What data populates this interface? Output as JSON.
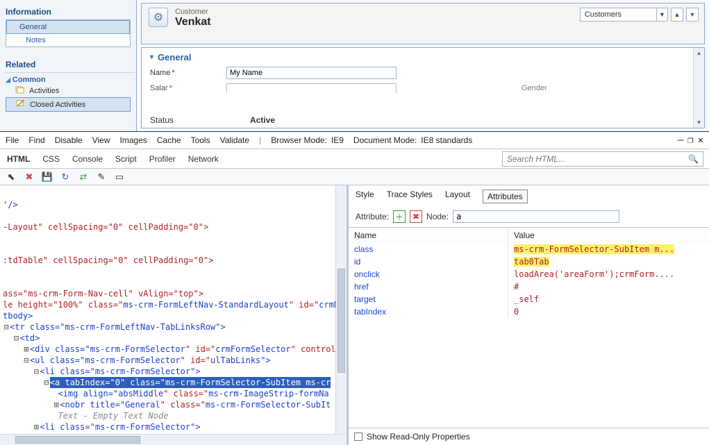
{
  "sidebar": {
    "info_heading": "Information",
    "items": [
      "General",
      "Notes"
    ],
    "related_heading": "Related",
    "common_heading": "Common",
    "activities": "Activities",
    "closed_activities": "Closed Activities"
  },
  "header": {
    "entity_type": "Customer",
    "entity_name": "Venkat",
    "lookup_value": "Customers"
  },
  "form": {
    "section": "General",
    "name_label": "Name",
    "name_value": "My Name",
    "salary_label": "Salar",
    "gender_label": "Gender",
    "status_label": "Status",
    "status_value": "Active"
  },
  "devtools": {
    "menu": [
      "File",
      "Find",
      "Disable",
      "View",
      "Images",
      "Cache",
      "Tools",
      "Validate"
    ],
    "mode_browser_label": "Browser Mode:",
    "mode_browser": "IE9",
    "mode_doc_label": "Document Mode:",
    "mode_doc": "IE8 standards",
    "tabs": [
      "HTML",
      "CSS",
      "Console",
      "Script",
      "Profiler",
      "Network"
    ],
    "search_placeholder": "Search HTML...",
    "right_tabs": [
      "Style",
      "Trace Styles",
      "Layout",
      "Attributes"
    ],
    "attribute_label": "Attribute:",
    "node_label": "Node:",
    "node_value": "a",
    "grid_headers": {
      "name": "Name",
      "value": "Value"
    },
    "rows": [
      {
        "n": "class",
        "v": "ms-crm-FormSelector-SubItem m..."
      },
      {
        "n": "id",
        "v": "tab0Tab"
      },
      {
        "n": "onclick",
        "v": "loadArea('areaForm');crmForm...."
      },
      {
        "n": "href",
        "v": "#"
      },
      {
        "n": "target",
        "v": "_self"
      },
      {
        "n": "tabIndex",
        "v": "0"
      }
    ],
    "footer_label": "Show Read-Only Properties"
  },
  "dom_lines": {
    "l1": "'/>",
    "l2": "-Layout\" cellSpacing=\"0\" cellPadding=\"0\">",
    "l3": ":tdTable\" cellSpacing=\"0\" cellPadding=\"0\">",
    "l4": "ass=\"ms-crm-Form-Nav-cell\" vAlign=\"top\">",
    "l5a": "le height=\"100%\" class=\"",
    "l5b": "ms-crm-FormLeftNav-StandardLayout",
    "l5c": "\" id=\"",
    "l5d": "crmNav",
    "l6": "tbody>",
    "l7a": "<tr class=\"",
    "l7b": "ms-crm-FormLeftNav-TabLinksRow",
    "l7c": "\">",
    "l8": "<td>",
    "l9a": "<div class=\"",
    "l9b": "ms-crm-FormSelector",
    "l9c": "\" id=\"",
    "l9d": "crmFormSelector",
    "l9e": "\" control=",
    "l10a": "<ul class=\"",
    "l10b": "ms-crm-FormSelector",
    "l10c": "\" id=\"",
    "l10d": "ulTabLinks",
    "l10e": "\">",
    "l11a": "<li class=\"",
    "l11b": "ms-crm-FormSelector",
    "l11c": "\">",
    "l12a": "<a tabIndex=\"0\" class=\"",
    "l12b": "ms-crm-FormSelector-SubItem ms-cr",
    "l13a": "<img align=\"",
    "l13b": "absMiddle",
    "l13c": "\" class=\"",
    "l13d": "ms-crm-ImageStrip-formNa",
    "l14a": "<nobr title=\"",
    "l14b": "General",
    "l14c": "\" class=\"",
    "l14d": "ms-crm-FormSelector-SubIt",
    "l15": "Text - Empty Text Node",
    "l16a": "<li class=\"",
    "l16b": "ms-crm-FormSelector",
    "l16c": "\">"
  }
}
